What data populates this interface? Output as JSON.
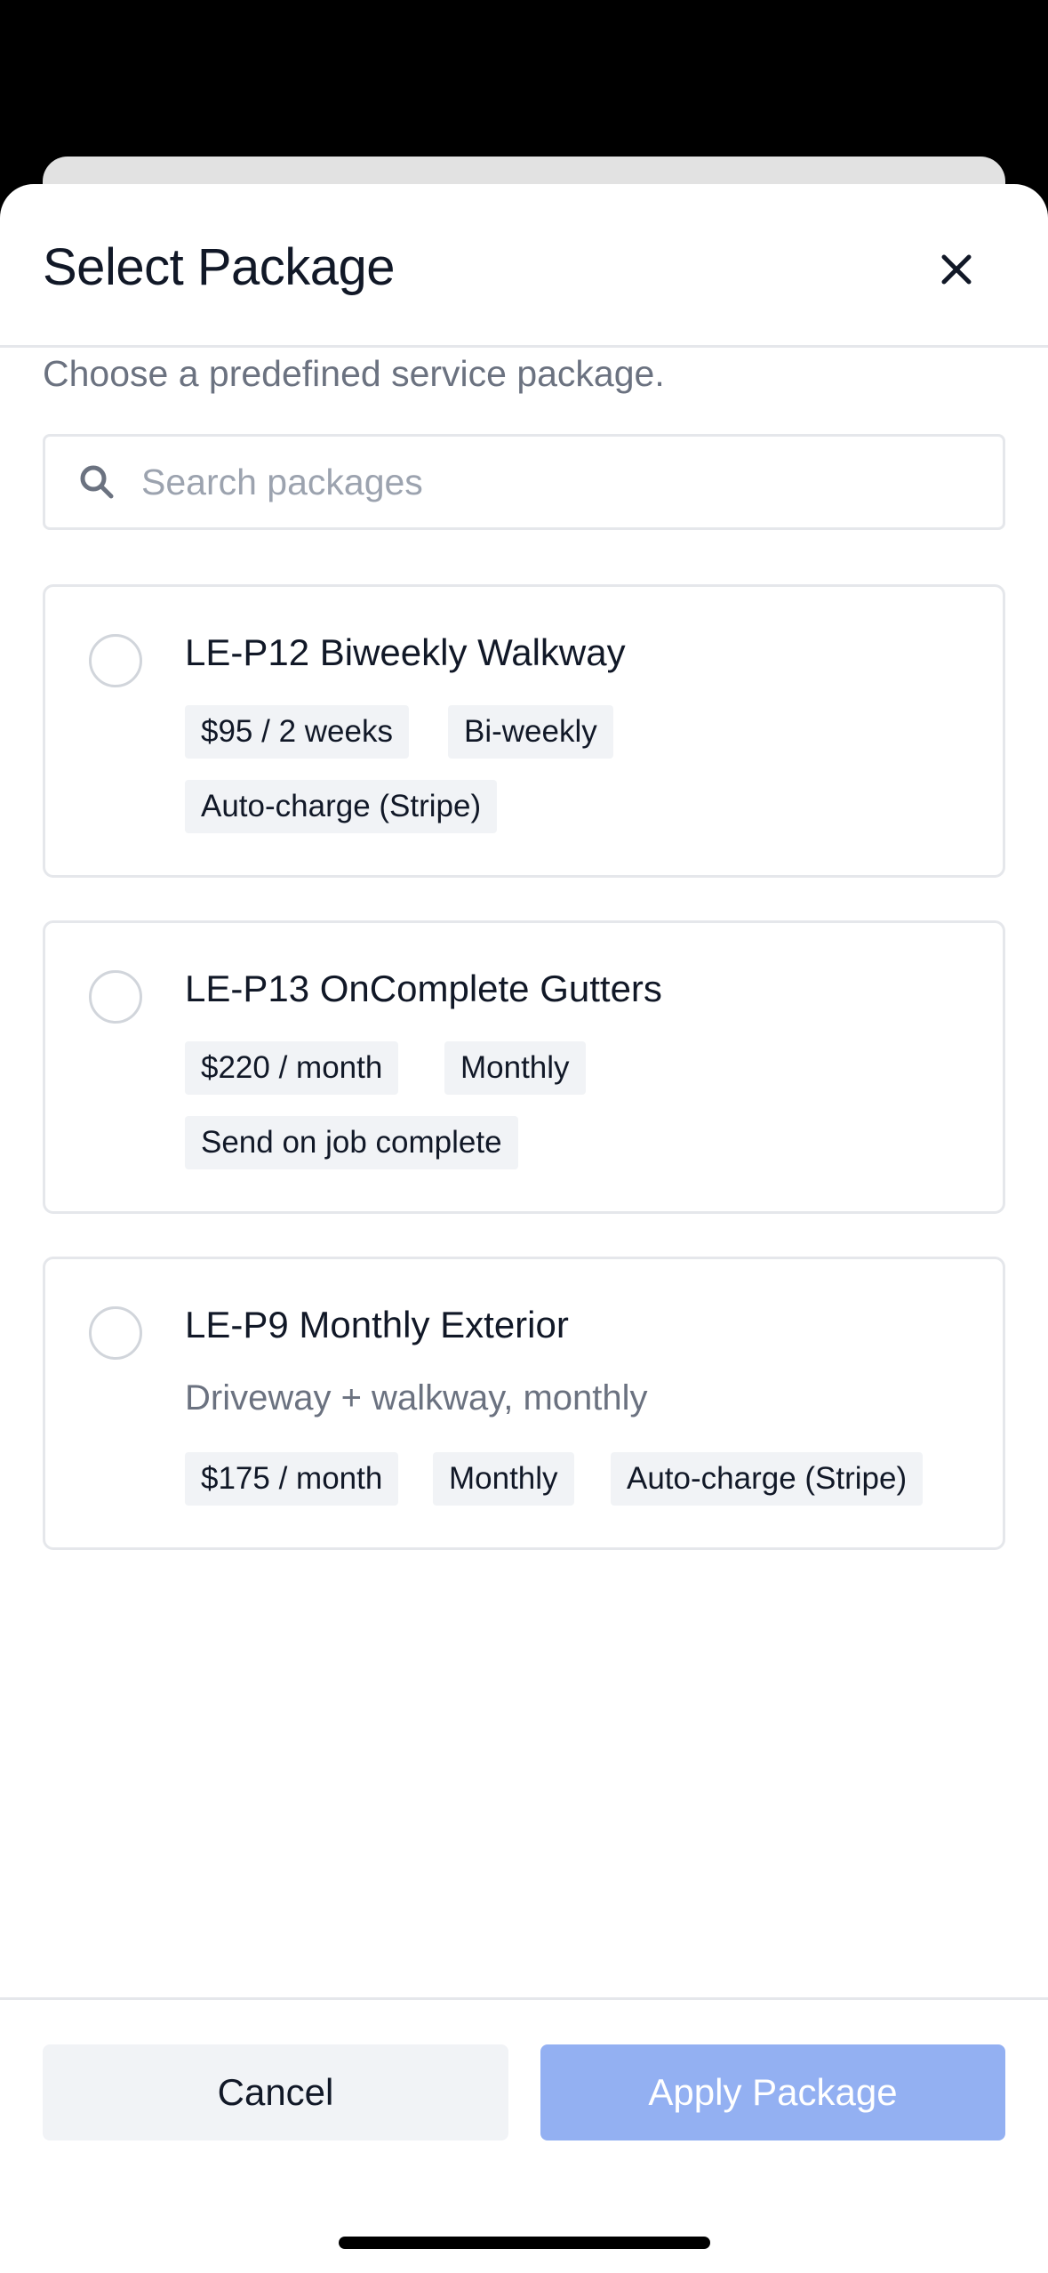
{
  "modal": {
    "title": "Select Package",
    "subtitle": "Choose a predefined service package."
  },
  "search": {
    "placeholder": "Search packages",
    "value": ""
  },
  "packages": [
    {
      "name": "LE-P12 Biweekly Walkway",
      "description": "",
      "price": "$95 / 2 weeks",
      "frequency": "Bi-weekly",
      "billing": "Auto-charge (Stripe)",
      "selected": false
    },
    {
      "name": "LE-P13 OnComplete Gutters",
      "description": "",
      "price": "$220 / month",
      "frequency": "Monthly",
      "billing": "Send on job complete",
      "selected": false
    },
    {
      "name": "LE-P9 Monthly Exterior",
      "description": "Driveway + walkway, monthly",
      "price": "$175 / month",
      "frequency": "Monthly",
      "billing": "Auto-charge (Stripe)",
      "selected": false
    }
  ],
  "footer": {
    "cancel_label": "Cancel",
    "apply_label": "Apply Package"
  },
  "icons": {
    "close": "close-icon",
    "search": "search-icon"
  },
  "colors": {
    "apply_button_disabled": "#93b0f2",
    "secondary_button": "#f1f3f6",
    "tag_background": "#f1f3f6",
    "text_primary": "#111827",
    "text_muted": "#6b7280"
  }
}
